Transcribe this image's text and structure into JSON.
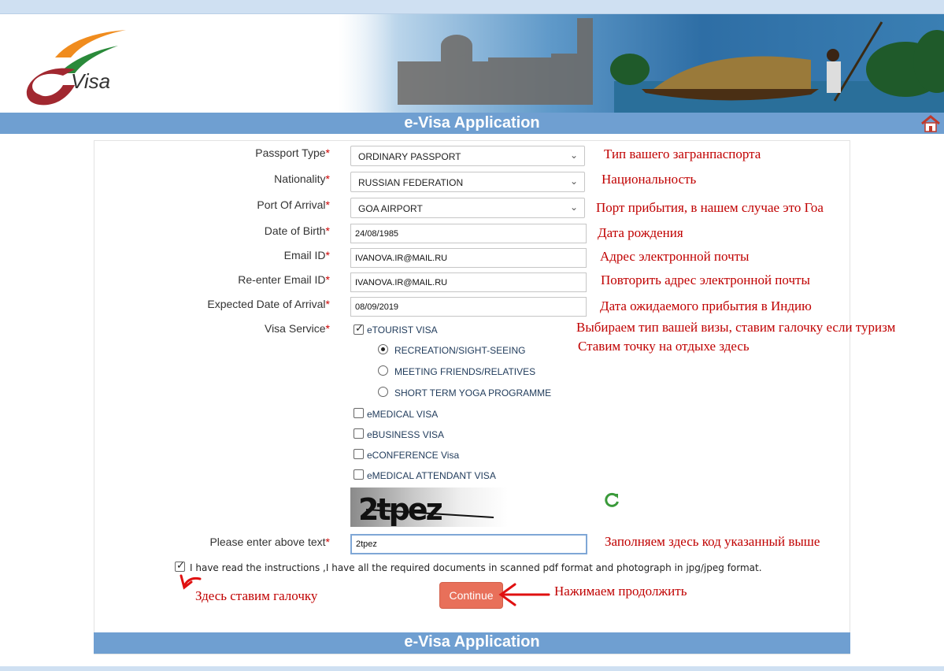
{
  "header": {
    "logo_text": "Visa",
    "title": "e-Visa Application"
  },
  "form": {
    "passport_type": {
      "label": "Passport Type",
      "value": "ORDINARY PASSPORT"
    },
    "nationality": {
      "label": "Nationality",
      "value": "RUSSIAN FEDERATION"
    },
    "port_of_arrival": {
      "label": "Port Of Arrival",
      "value": "GOA AIRPORT"
    },
    "date_of_birth": {
      "label": "Date of Birth",
      "value": "24/08/1985"
    },
    "email": {
      "label": "Email ID",
      "value": "IVANOVA.IR@MAIL.RU"
    },
    "reenter_email": {
      "label": "Re-enter Email ID",
      "value": "IVANOVA.IR@MAIL.RU"
    },
    "expected_arrival": {
      "label": "Expected Date of Arrival",
      "value": "08/09/2019"
    },
    "visa_service": {
      "label": "Visa Service",
      "etourist": "eTOURIST VISA",
      "sub_options": [
        "RECREATION/SIGHT-SEEING",
        "MEETING FRIENDS/RELATIVES",
        "SHORT TERM YOGA PROGRAMME"
      ],
      "other": [
        "eMEDICAL VISA",
        "eBUSINESS VISA",
        "eCONFERENCE Visa",
        "eMEDICAL ATTENDANT VISA"
      ]
    },
    "captcha_text": "2tpez",
    "captcha_input": {
      "label": "Please enter above text",
      "value": "2tpez"
    },
    "declaration": "I have read the instructions ,I have all the required documents in scanned pdf format and photograph in jpg/jpeg format.",
    "continue_label": "Continue",
    "required_mark": "*"
  },
  "annotations": {
    "passport_type": "Тип вашего загранпаспорта",
    "nationality": "Национальность",
    "port": "Порт прибытия, в нашем случае это Гоа",
    "dob": "Дата рождения",
    "email": "Адрес электронной почты",
    "reemail": "Повторить адрес электронной почты",
    "arrival": "Дата ожидаемого прибытия в Индию",
    "visa_type": "Выбираем тип вашей визы, ставим галочку если туризм",
    "recreation": "Ставим точку на отдыхе здесь",
    "captcha": "Заполняем здесь код указанный выше",
    "checkbox": "Здесь ставим галочку",
    "continue": "Нажимаем продолжить"
  },
  "footer": {
    "title": "e-Visa Application"
  },
  "colors": {
    "bar_blue": "#6f9fd1",
    "continue_btn": "#e8705a",
    "annotation_red": "#c00000"
  }
}
